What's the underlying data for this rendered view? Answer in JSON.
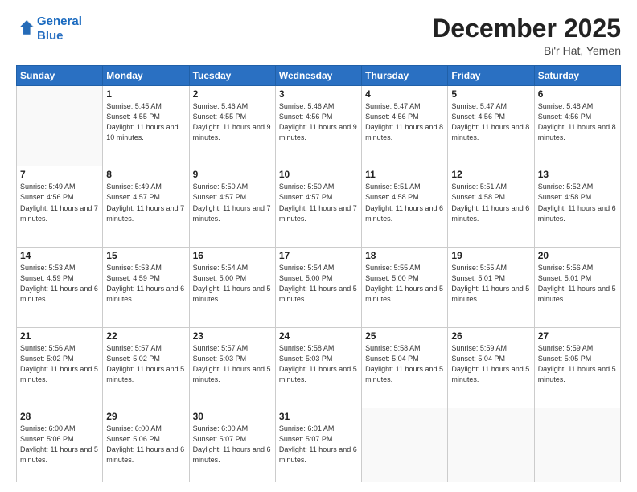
{
  "header": {
    "logo_line1": "General",
    "logo_line2": "Blue",
    "month": "December 2025",
    "location": "Bi'r Hat, Yemen"
  },
  "weekdays": [
    "Sunday",
    "Monday",
    "Tuesday",
    "Wednesday",
    "Thursday",
    "Friday",
    "Saturday"
  ],
  "weeks": [
    [
      {
        "day": "",
        "info": ""
      },
      {
        "day": "1",
        "info": "Sunrise: 5:45 AM\nSunset: 4:55 PM\nDaylight: 11 hours\nand 10 minutes."
      },
      {
        "day": "2",
        "info": "Sunrise: 5:46 AM\nSunset: 4:55 PM\nDaylight: 11 hours\nand 9 minutes."
      },
      {
        "day": "3",
        "info": "Sunrise: 5:46 AM\nSunset: 4:56 PM\nDaylight: 11 hours\nand 9 minutes."
      },
      {
        "day": "4",
        "info": "Sunrise: 5:47 AM\nSunset: 4:56 PM\nDaylight: 11 hours\nand 8 minutes."
      },
      {
        "day": "5",
        "info": "Sunrise: 5:47 AM\nSunset: 4:56 PM\nDaylight: 11 hours\nand 8 minutes."
      },
      {
        "day": "6",
        "info": "Sunrise: 5:48 AM\nSunset: 4:56 PM\nDaylight: 11 hours\nand 8 minutes."
      }
    ],
    [
      {
        "day": "7",
        "info": "Sunrise: 5:49 AM\nSunset: 4:56 PM\nDaylight: 11 hours\nand 7 minutes."
      },
      {
        "day": "8",
        "info": "Sunrise: 5:49 AM\nSunset: 4:57 PM\nDaylight: 11 hours\nand 7 minutes."
      },
      {
        "day": "9",
        "info": "Sunrise: 5:50 AM\nSunset: 4:57 PM\nDaylight: 11 hours\nand 7 minutes."
      },
      {
        "day": "10",
        "info": "Sunrise: 5:50 AM\nSunset: 4:57 PM\nDaylight: 11 hours\nand 7 minutes."
      },
      {
        "day": "11",
        "info": "Sunrise: 5:51 AM\nSunset: 4:58 PM\nDaylight: 11 hours\nand 6 minutes."
      },
      {
        "day": "12",
        "info": "Sunrise: 5:51 AM\nSunset: 4:58 PM\nDaylight: 11 hours\nand 6 minutes."
      },
      {
        "day": "13",
        "info": "Sunrise: 5:52 AM\nSunset: 4:58 PM\nDaylight: 11 hours\nand 6 minutes."
      }
    ],
    [
      {
        "day": "14",
        "info": "Sunrise: 5:53 AM\nSunset: 4:59 PM\nDaylight: 11 hours\nand 6 minutes."
      },
      {
        "day": "15",
        "info": "Sunrise: 5:53 AM\nSunset: 4:59 PM\nDaylight: 11 hours\nand 6 minutes."
      },
      {
        "day": "16",
        "info": "Sunrise: 5:54 AM\nSunset: 5:00 PM\nDaylight: 11 hours\nand 5 minutes."
      },
      {
        "day": "17",
        "info": "Sunrise: 5:54 AM\nSunset: 5:00 PM\nDaylight: 11 hours\nand 5 minutes."
      },
      {
        "day": "18",
        "info": "Sunrise: 5:55 AM\nSunset: 5:00 PM\nDaylight: 11 hours\nand 5 minutes."
      },
      {
        "day": "19",
        "info": "Sunrise: 5:55 AM\nSunset: 5:01 PM\nDaylight: 11 hours\nand 5 minutes."
      },
      {
        "day": "20",
        "info": "Sunrise: 5:56 AM\nSunset: 5:01 PM\nDaylight: 11 hours\nand 5 minutes."
      }
    ],
    [
      {
        "day": "21",
        "info": "Sunrise: 5:56 AM\nSunset: 5:02 PM\nDaylight: 11 hours\nand 5 minutes."
      },
      {
        "day": "22",
        "info": "Sunrise: 5:57 AM\nSunset: 5:02 PM\nDaylight: 11 hours\nand 5 minutes."
      },
      {
        "day": "23",
        "info": "Sunrise: 5:57 AM\nSunset: 5:03 PM\nDaylight: 11 hours\nand 5 minutes."
      },
      {
        "day": "24",
        "info": "Sunrise: 5:58 AM\nSunset: 5:03 PM\nDaylight: 11 hours\nand 5 minutes."
      },
      {
        "day": "25",
        "info": "Sunrise: 5:58 AM\nSunset: 5:04 PM\nDaylight: 11 hours\nand 5 minutes."
      },
      {
        "day": "26",
        "info": "Sunrise: 5:59 AM\nSunset: 5:04 PM\nDaylight: 11 hours\nand 5 minutes."
      },
      {
        "day": "27",
        "info": "Sunrise: 5:59 AM\nSunset: 5:05 PM\nDaylight: 11 hours\nand 5 minutes."
      }
    ],
    [
      {
        "day": "28",
        "info": "Sunrise: 6:00 AM\nSunset: 5:06 PM\nDaylight: 11 hours\nand 5 minutes."
      },
      {
        "day": "29",
        "info": "Sunrise: 6:00 AM\nSunset: 5:06 PM\nDaylight: 11 hours\nand 6 minutes."
      },
      {
        "day": "30",
        "info": "Sunrise: 6:00 AM\nSunset: 5:07 PM\nDaylight: 11 hours\nand 6 minutes."
      },
      {
        "day": "31",
        "info": "Sunrise: 6:01 AM\nSunset: 5:07 PM\nDaylight: 11 hours\nand 6 minutes."
      },
      {
        "day": "",
        "info": ""
      },
      {
        "day": "",
        "info": ""
      },
      {
        "day": "",
        "info": ""
      }
    ]
  ]
}
